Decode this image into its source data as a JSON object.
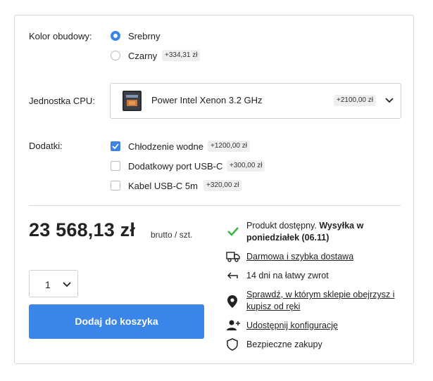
{
  "housing_color": {
    "label": "Kolor obudowy:",
    "options": [
      {
        "label": "Srebrny",
        "selected": true,
        "price": ""
      },
      {
        "label": "Czarny",
        "selected": false,
        "price": "+334,31 zł"
      }
    ]
  },
  "cpu": {
    "label": "Jednostka CPU:",
    "selected_value": "Power Intel Xenon 3.2 GHz",
    "price": "+2100,00 zł"
  },
  "addons": {
    "label": "Dodatki:",
    "options": [
      {
        "label": "Chłodzenie wodne",
        "checked": true,
        "price": "+1200,00 zł"
      },
      {
        "label": "Dodatkowy port USB-C",
        "checked": false,
        "price": "+300,00 zł"
      },
      {
        "label": "Kabel USB-C 5m",
        "checked": false,
        "price": "+320,00 zł"
      }
    ]
  },
  "price": {
    "amount": "23 568,13 zł",
    "suffix": "brutto / szt."
  },
  "quantity": {
    "value": "1"
  },
  "cart": {
    "button_label": "Dodaj do koszyka"
  },
  "info": {
    "availability_prefix": "Produkt dostępny.",
    "availability_bold_1": "Wysyłka w",
    "availability_bold_2": "poniedziałek (06.11)",
    "delivery": "Darmowa i szybka dostawa",
    "returns": "14 dni na łatwy zwrot",
    "store_line_1": "Sprawdź, w którym sklepie obejrzysz i",
    "store_line_2": "kupisz od ręki",
    "share": "Udostępnij konfigurację",
    "secure": "Bezpieczne zakupy"
  },
  "colors": {
    "accent": "#3a86e8",
    "check_green": "#3db54a"
  },
  "icons": [
    "chevron-down-icon",
    "cpu-chip-icon",
    "checkmark-icon",
    "truck-icon",
    "return-arrow-icon",
    "map-pin-icon",
    "add-user-icon",
    "shield-icon"
  ]
}
